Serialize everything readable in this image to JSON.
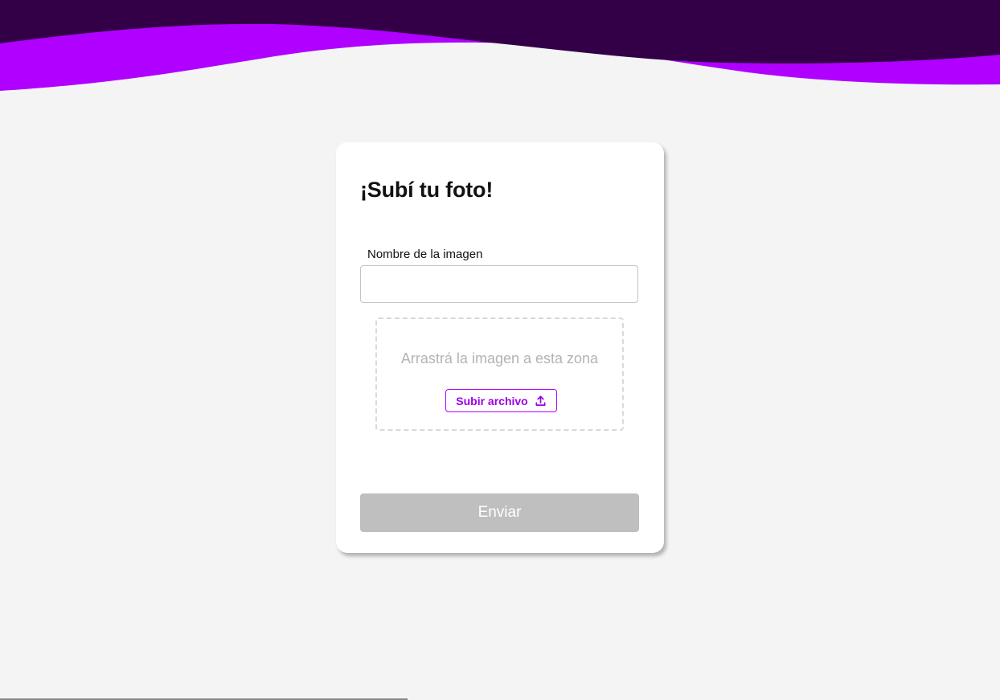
{
  "colors": {
    "background": "#f4f4f4",
    "wave_dark": "#330048",
    "wave_accent": "#b000ff",
    "card": "#ffffff",
    "accent_text": "#9a00e6",
    "disabled_button": "#bfbfbf"
  },
  "upload_card": {
    "title": "¡Subí tu foto!",
    "name_field": {
      "label": "Nombre de la imagen",
      "value": "",
      "placeholder": ""
    },
    "dropzone": {
      "hint": "Arrastrá la imagen a esta zona",
      "upload_button_label": "Subir archivo",
      "upload_button_icon": "upload-icon"
    },
    "submit_button_label": "Enviar",
    "submit_disabled": true
  }
}
